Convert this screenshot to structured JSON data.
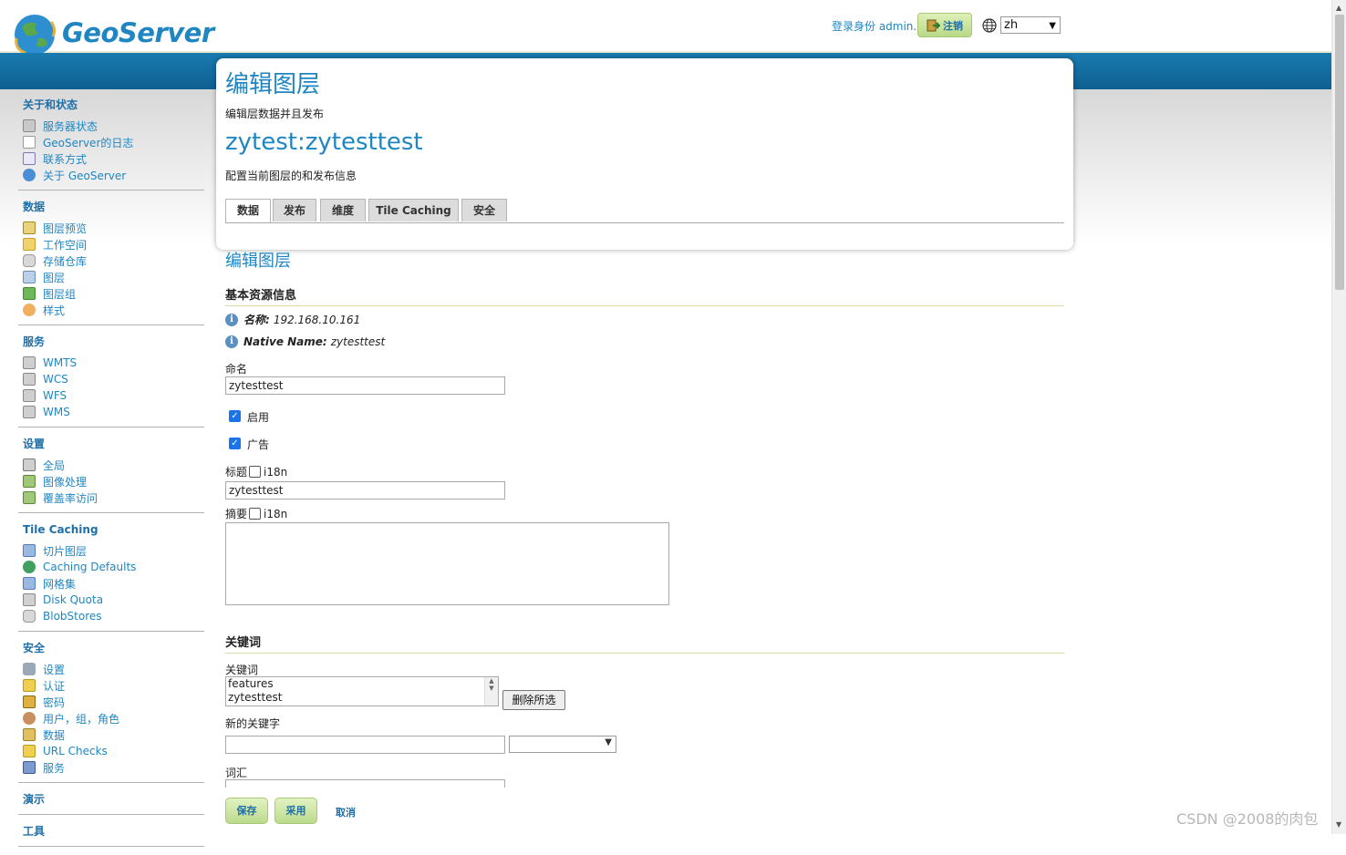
{
  "header": {
    "brand": "GeoServer",
    "login_text": "登录身份 admin.",
    "logout_label": "注销",
    "language": "zh"
  },
  "sidebar": {
    "sections": [
      {
        "title": "关于和状态",
        "items": [
          {
            "label": "服务器状态",
            "icon": "server-status-icon"
          },
          {
            "label": "GeoServer的日志",
            "icon": "log-icon"
          },
          {
            "label": "联系方式",
            "icon": "contact-icon"
          },
          {
            "label": "关于 GeoServer",
            "icon": "about-icon"
          }
        ]
      },
      {
        "title": "数据",
        "items": [
          {
            "label": "图层预览",
            "icon": "layer-preview-icon"
          },
          {
            "label": "工作空间",
            "icon": "folder-icon"
          },
          {
            "label": "存储仓库",
            "icon": "database-icon"
          },
          {
            "label": "图层",
            "icon": "layer-icon"
          },
          {
            "label": "图层组",
            "icon": "layer-group-icon"
          },
          {
            "label": "样式",
            "icon": "palette-icon"
          }
        ]
      },
      {
        "title": "服务",
        "items": [
          {
            "label": "WMTS",
            "icon": "service-icon"
          },
          {
            "label": "WCS",
            "icon": "service-icon"
          },
          {
            "label": "WFS",
            "icon": "service-icon"
          },
          {
            "label": "WMS",
            "icon": "service-icon"
          }
        ]
      },
      {
        "title": "设置",
        "items": [
          {
            "label": "全局",
            "icon": "server-icon"
          },
          {
            "label": "图像处理",
            "icon": "image-icon"
          },
          {
            "label": "覆盖率访问",
            "icon": "image-icon"
          }
        ]
      },
      {
        "title": "Tile Caching",
        "items": [
          {
            "label": "切片图层",
            "icon": "grid-icon"
          },
          {
            "label": "Caching Defaults",
            "icon": "globe-icon"
          },
          {
            "label": "网格集",
            "icon": "grid-icon"
          },
          {
            "label": "Disk Quota",
            "icon": "disk-icon"
          },
          {
            "label": "BlobStores",
            "icon": "database-icon"
          }
        ]
      },
      {
        "title": "安全",
        "items": [
          {
            "label": "设置",
            "icon": "wrench-icon"
          },
          {
            "label": "认证",
            "icon": "shield-icon"
          },
          {
            "label": "密码",
            "icon": "lock-icon"
          },
          {
            "label": "用户，组，角色",
            "icon": "users-icon"
          },
          {
            "label": "数据",
            "icon": "data-security-icon"
          },
          {
            "label": "URL Checks",
            "icon": "shield-icon"
          },
          {
            "label": "服务",
            "icon": "service-security-icon"
          }
        ]
      },
      {
        "title": "演示",
        "items": []
      },
      {
        "title": "工具",
        "items": []
      }
    ]
  },
  "main": {
    "page_title": "编辑图层",
    "page_description": "编辑层数据并且发布",
    "layer_title": "zytest:zytesttest",
    "layer_description": "配置当前图层的和发布信息",
    "tabs": [
      {
        "label": "数据"
      },
      {
        "label": "发布"
      },
      {
        "label": "维度"
      },
      {
        "label": "Tile Caching"
      },
      {
        "label": "安全"
      }
    ],
    "section_heading": "编辑图层",
    "basic_info_heading": "基本资源信息",
    "name_info_label": "名称:",
    "name_info_value": "192.168.10.161",
    "native_name_label": "Native Name:",
    "native_name_value": "zytesttest",
    "name_field_label": "命名",
    "name_field_value": "zytesttest",
    "enabled_label": "启用",
    "advertised_label": "广告",
    "title_label": "标题",
    "i18n_label": "i18n",
    "title_value": "zytesttest",
    "abstract_label": "摘要",
    "keywords_heading": "关键词",
    "keywords_label": "关键词",
    "keywords": [
      "features",
      "zytesttest"
    ],
    "remove_selected_label": "删除所选",
    "new_keyword_label": "新的关键字",
    "vocabulary_label": "词汇",
    "save_label": "保存",
    "apply_label": "采用",
    "cancel_label": "取消"
  },
  "watermark": "CSDN @2008的肉包"
}
